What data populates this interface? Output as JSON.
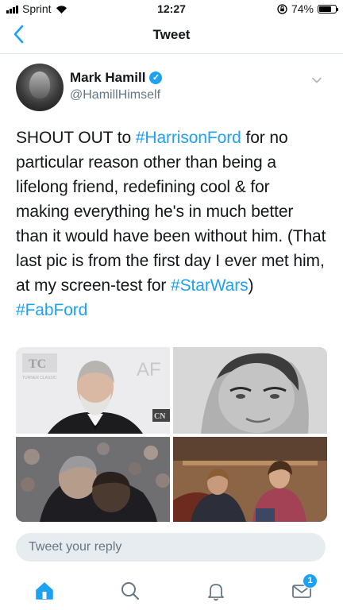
{
  "status_bar": {
    "carrier": "Sprint",
    "time": "12:27",
    "battery": "74%",
    "battery_level": 0.74
  },
  "nav": {
    "title": "Tweet"
  },
  "tweet": {
    "author_name": "Mark Hamill",
    "author_handle": "@HamillHimself",
    "text_parts": [
      {
        "text": "SHOUT OUT to ",
        "type": "text"
      },
      {
        "text": "#HarrisonFord",
        "type": "hashtag"
      },
      {
        "text": " for no particular reason other than being a lifelong friend, redefining cool & for making everything he's in much better than it would have been without him. (That last pic is from the first day I ever met him, at my screen-test for ",
        "type": "text"
      },
      {
        "text": "#StarWars",
        "type": "hashtag"
      },
      {
        "text": ") ",
        "type": "text"
      },
      {
        "text": "#FabFord",
        "type": "hashtag"
      }
    ],
    "media": {
      "photo1_sign_text": "TC",
      "photo1_sub_text": "TURNER CLASSIC",
      "photo1_letters": "AF",
      "photo1_bottom_text": "CN"
    }
  },
  "reply_box": {
    "placeholder": "Tweet your reply"
  },
  "tabbar": {
    "messages_badge": "1"
  },
  "colors": {
    "accent": "#1da1f2",
    "secondary_text": "#657786",
    "reply_bg": "#e6ecf0"
  }
}
